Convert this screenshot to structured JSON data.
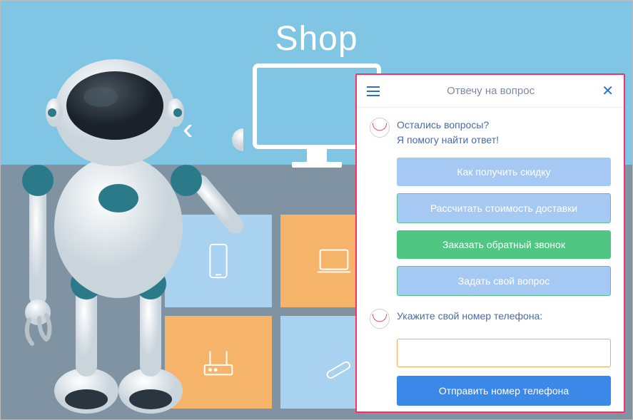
{
  "background": {
    "title": "Shop"
  },
  "chat": {
    "header_title": "Отвечу на вопрос",
    "greeting": {
      "line1": "Остались вопросы?",
      "line2": "Я помогу найти ответ!"
    },
    "actions": [
      {
        "label": "Как получить скидку",
        "style": "blue"
      },
      {
        "label": "Рассчитать стоимость доставки",
        "style": "blue-bordered"
      },
      {
        "label": "Заказать обратный звонок",
        "style": "green"
      },
      {
        "label": "Задать свой вопрос",
        "style": "blue-bordered"
      }
    ],
    "phone_prompt": "Укажите свой номер телефона:",
    "phone_placeholder": "",
    "submit_label": "Отправить номер телефона"
  },
  "icons": {
    "phone": "phone-icon",
    "laptop": "laptop-icon",
    "router": "router-icon",
    "pen": "pen-icon"
  },
  "colors": {
    "accent_red": "#ff3060",
    "accent_blue": "#3a88e8",
    "accent_green": "#4fc681",
    "bg_sky": "#80c5e3",
    "bg_grey": "#8093a2"
  }
}
